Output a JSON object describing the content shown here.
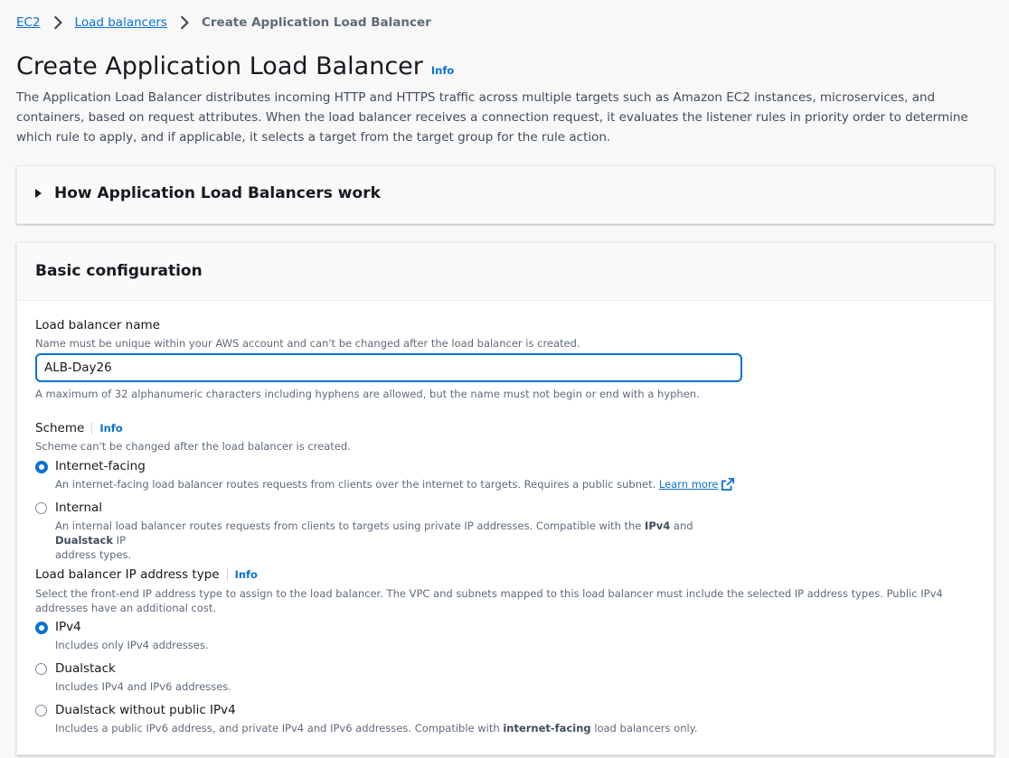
{
  "breadcrumb": {
    "ec2": "EC2",
    "load_balancers": "Load balancers",
    "current": "Create Application Load Balancer"
  },
  "page": {
    "title": "Create Application Load Balancer",
    "info": "Info",
    "description": "The Application Load Balancer distributes incoming HTTP and HTTPS traffic across multiple targets such as Amazon EC2 instances, microservices, and containers, based on request attributes. When the load balancer receives a connection request, it evaluates the listener rules in priority order to determine which rule to apply, and if applicable, it selects a target from the target group for the rule action."
  },
  "how_section": {
    "title": "How Application Load Balancers work"
  },
  "basic": {
    "title": "Basic configuration",
    "name": {
      "label": "Load balancer name",
      "description": "Name must be unique within your AWS account and can't be changed after the load balancer is created.",
      "value": "ALB-Day26",
      "constraint": "A maximum of 32 alphanumeric characters including hyphens are allowed, but the name must not begin or end with a hyphen."
    },
    "scheme": {
      "label": "Scheme",
      "info": "Info",
      "description": "Scheme can't be changed after the load balancer is created.",
      "selected": "Internet-facing",
      "internet_facing": {
        "label": "Internet-facing",
        "desc": "An internet-facing load balancer routes requests from clients over the internet to targets. Requires a public subnet.",
        "learn_more": "Learn more"
      },
      "internal": {
        "label": "Internal",
        "desc_a": "An internal load balancer routes requests from clients to targets using private IP addresses. Compatible with the ",
        "desc_b": "IPv4",
        "desc_c": " and ",
        "desc_d": "Dualstack",
        "desc_e": " IP",
        "desc_f": "address types."
      }
    },
    "ip_type": {
      "label": "Load balancer IP address type",
      "info": "Info",
      "description": "Select the front-end IP address type to assign to the load balancer. The VPC and subnets mapped to this load balancer must include the selected IP address types. Public IPv4 addresses have an additional cost.",
      "selected": "IPv4",
      "ipv4": {
        "label": "IPv4",
        "desc": "Includes only IPv4 addresses."
      },
      "dualstack": {
        "label": "Dualstack",
        "desc": "Includes IPv4 and IPv6 addresses."
      },
      "dualstack_no_public": {
        "label": "Dualstack without public IPv4",
        "desc_a": "Includes a public IPv6 address, and private IPv4 and IPv6 addresses. Compatible with ",
        "desc_b": "internet-facing",
        "desc_c": " load balancers only."
      }
    }
  },
  "colors": {
    "link": "#0972d3",
    "text": "#16191f",
    "muted": "#5f6b7a",
    "background": "#f8f8f8"
  }
}
